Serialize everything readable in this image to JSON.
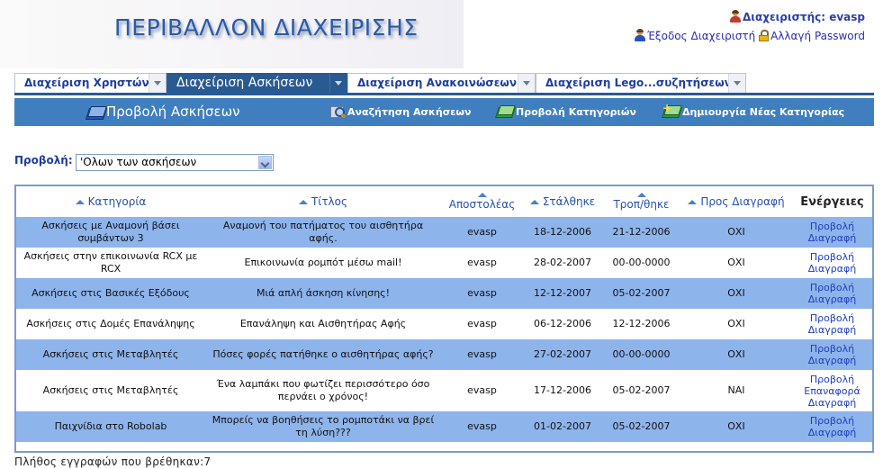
{
  "header": {
    "title": "ΠΕΡΙΒΑΛΛΟΝ ΔΙΑΧΕΙΡΙΣΗΣ",
    "admin_label": "Διαχειριστής: evasp",
    "logout_label": "Έξοδος Διαχειριστή",
    "change_password_label": "Αλλαγή Password"
  },
  "tabs": [
    {
      "label": "Διαχείριση Χρηστών"
    },
    {
      "label": "Διαχείριση Ασκήσεων"
    },
    {
      "label": "Διαχείριση Ανακοινώσεων"
    },
    {
      "label": "Διαχείριση Lego...συζητήσεων"
    }
  ],
  "subnav": {
    "view_label": "Προβολή Ασκήσεων",
    "search_label": "Αναζήτηση Ασκήσεων",
    "categories_label": "Προβολή Κατηγοριών",
    "new_category_label": "Δημιουργία Νέας Κατηγορίας"
  },
  "filter": {
    "label": "Προβολή:",
    "selected": "'Ολων των ασκήσεων"
  },
  "table": {
    "headers": {
      "category": "Κατηγορία",
      "title": "Τίτλος",
      "sender": "Αποστολέας",
      "sent": "Στάλθηκε",
      "modified": "Τροπ/θηκε",
      "to_delete": "Προς Διαγραφή",
      "actions": "Ενέργειες"
    },
    "rows": [
      {
        "category": "Ασκήσεις με Αναμονή βάσει συμβάντων 3",
        "title": "Αναμονή του πατήματος του αισθητήρα αφής.",
        "sender": "evasp",
        "sent": "18-12-2006",
        "modified": "21-12-2006",
        "to_delete": "ΟΧΙ",
        "actions": [
          "Προβολή",
          "Διαγραφή"
        ]
      },
      {
        "category": "Ασκήσεις στην επικοινωνία RCX με RCX",
        "title": "Επικοινωνία ρομπότ μέσω mail!",
        "sender": "evasp",
        "sent": "28-02-2007",
        "modified": "00-00-0000",
        "to_delete": "ΟΧΙ",
        "actions": [
          "Προβολή",
          "Διαγραφή"
        ]
      },
      {
        "category": "Ασκήσεις στις Βασικές Εξόδους",
        "title": "Μιά απλή άσκηση κίνησης!",
        "sender": "evasp",
        "sent": "12-12-2007",
        "modified": "05-02-2007",
        "to_delete": "ΟΧΙ",
        "actions": [
          "Προβολή",
          "Διαγραφή"
        ]
      },
      {
        "category": "Ασκήσεις στις Δομές Επανάληψης",
        "title": "Επανάληψη και Αισθητήρας Αφής",
        "sender": "evasp",
        "sent": "06-12-2006",
        "modified": "12-12-2006",
        "to_delete": "ΟΧΙ",
        "actions": [
          "Προβολή",
          "Διαγραφή"
        ]
      },
      {
        "category": "Ασκήσεις στις Μεταβλητές",
        "title": "Πόσες φορές πατήθηκε ο αισθητήρας αφής?",
        "sender": "evasp",
        "sent": "27-02-2007",
        "modified": "00-00-0000",
        "to_delete": "ΟΧΙ",
        "actions": [
          "Προβολή",
          "Διαγραφή"
        ]
      },
      {
        "category": "Ασκήσεις στις Μεταβλητές",
        "title": "Ένα λαμπάκι που φωτίζει περισσότερο όσο περνάει ο χρόνος!",
        "sender": "evasp",
        "sent": "17-12-2006",
        "modified": "05-02-2007",
        "to_delete": "ΝΑΙ",
        "actions": [
          "Προβολή",
          "Επαναφορά",
          "Διαγραφή"
        ]
      },
      {
        "category": "Παιχνίδια στο Robolab",
        "title": "Μπορείς να βοηθήσεις το ρομποτάκι να βρεί τη λύση???",
        "sender": "evasp",
        "sent": "01-02-2007",
        "modified": "05-02-2007",
        "to_delete": "ΟΧΙ",
        "actions": [
          "Προβολή",
          "Διαγραφή"
        ]
      }
    ]
  },
  "footer": {
    "count_text": "Πλήθος εγγραφών που βρέθηκαν:7"
  }
}
